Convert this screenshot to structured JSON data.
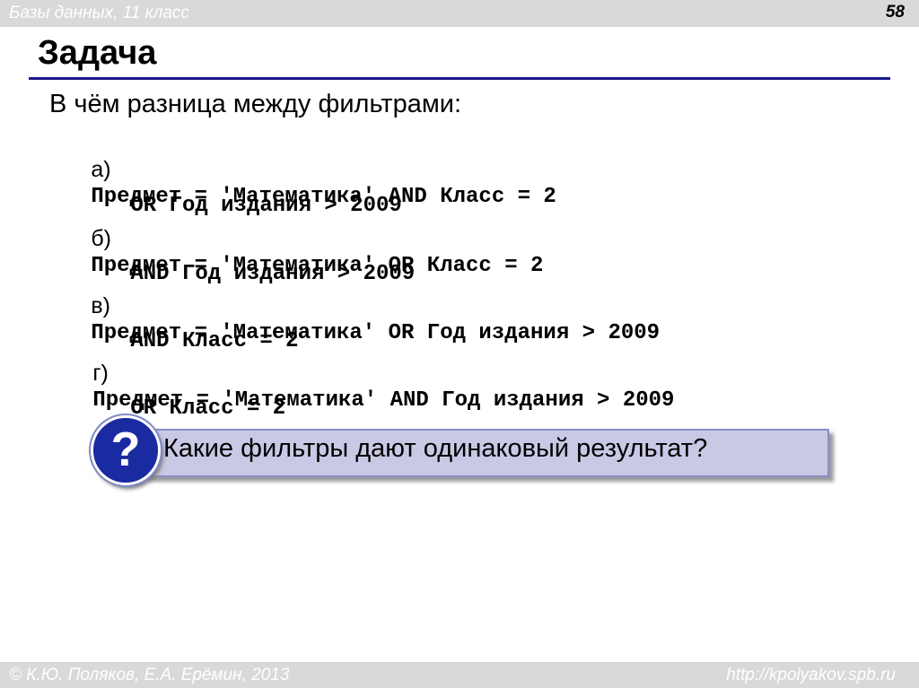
{
  "header": {
    "course": "Базы данных, 11 класс",
    "slide_number": "58"
  },
  "title": "Задача",
  "question": "В чём разница между фильтрами:",
  "options": [
    {
      "label": "а)",
      "line1": "Предмет = 'Математика' AND Класс = 2",
      "line2": "OR Год издания > 2009"
    },
    {
      "label": "б)",
      "line1": "Предмет = 'Математика' OR Класс = 2",
      "line2": "AND Год издания > 2009"
    },
    {
      "label": "в)",
      "line1": "Предмет = 'Математика' OR Год издания > 2009",
      "line2": "AND Класс = 2"
    },
    {
      "label": "г)",
      "line1": "Предмет = 'Математика' AND Год издания > 2009",
      "line2": "OR Класс = 2"
    }
  ],
  "callout": {
    "icon_char": "?",
    "text": "Какие фильтры дают одинаковый результат?"
  },
  "footer": {
    "authors": "© К.Ю. Поляков, Е.А. Ерёмин, 2013",
    "url": "http://kpolyakov.spb.ru"
  },
  "colors": {
    "rule": "#1a1a8a",
    "callout_bg": "#c9c9e6",
    "badge": "#1a2aa0",
    "bars": "#d9d9d9"
  }
}
